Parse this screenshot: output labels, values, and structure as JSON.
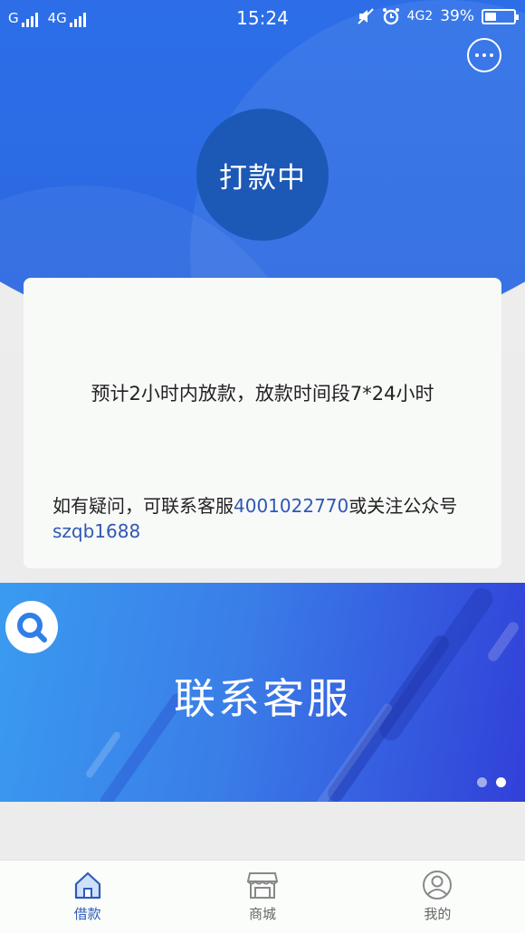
{
  "status_bar": {
    "carrier1": "G",
    "carrier2": "4G",
    "time": "15:24",
    "network": "4G2",
    "battery": "39%",
    "battery_level": 0.39
  },
  "header": {
    "status_text": "打款中"
  },
  "card": {
    "main_text": "预计2小时内放款，放款时间段7*24小时",
    "contact_prefix": "如有疑问，可联系客服",
    "phone": "4001022770",
    "contact_middle": "或关注公众号",
    "wechat_id": "szqb1688"
  },
  "banner": {
    "title": "联系客服",
    "slide_count": 2,
    "active_slide": 2
  },
  "tabbar": {
    "items": [
      {
        "label": "借款",
        "icon": "home-icon",
        "active": true
      },
      {
        "label": "商城",
        "icon": "store-icon",
        "active": false
      },
      {
        "label": "我的",
        "icon": "user-icon",
        "active": false
      }
    ]
  },
  "colors": {
    "primary": "#2e76ee",
    "status_circle": "#1c58b6",
    "link": "#2f57b5",
    "active_tab": "#2e5bb8"
  }
}
